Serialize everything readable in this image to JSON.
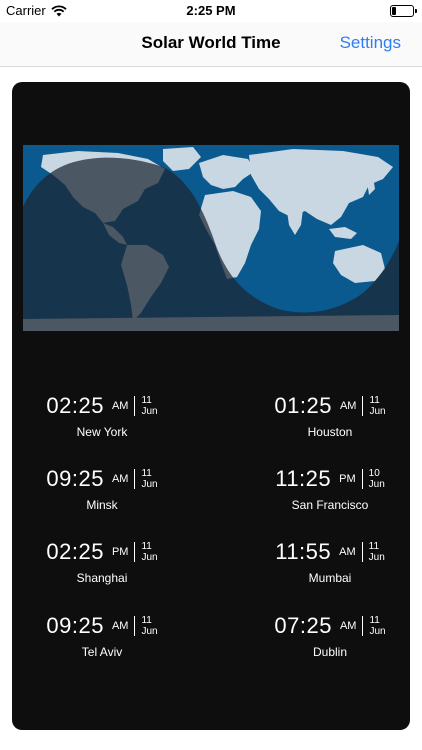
{
  "status_bar": {
    "carrier": "Carrier",
    "time": "2:25 PM"
  },
  "nav": {
    "title": "Solar World Time",
    "settings_label": "Settings"
  },
  "clocks": [
    {
      "time": "02:25",
      "ampm": "AM",
      "day": "11",
      "month": "Jun",
      "city": "New York"
    },
    {
      "time": "01:25",
      "ampm": "AM",
      "day": "11",
      "month": "Jun",
      "city": "Houston"
    },
    {
      "time": "09:25",
      "ampm": "AM",
      "day": "11",
      "month": "Jun",
      "city": "Minsk"
    },
    {
      "time": "11:25",
      "ampm": "PM",
      "day": "10",
      "month": "Jun",
      "city": "San Francisco"
    },
    {
      "time": "02:25",
      "ampm": "PM",
      "day": "11",
      "month": "Jun",
      "city": "Shanghai"
    },
    {
      "time": "11:55",
      "ampm": "AM",
      "day": "11",
      "month": "Jun",
      "city": "Mumbai"
    },
    {
      "time": "09:25",
      "ampm": "AM",
      "day": "11",
      "month": "Jun",
      "city": "Tel Aviv"
    },
    {
      "time": "07:25",
      "ampm": "AM",
      "day": "11",
      "month": "Jun",
      "city": "Dublin"
    }
  ],
  "colors": {
    "accent": "#2f7cf6",
    "card": "#0e0e0e",
    "ocean": "#0b5a8f",
    "land": "#c9d7e3",
    "night": "#1b2530"
  }
}
